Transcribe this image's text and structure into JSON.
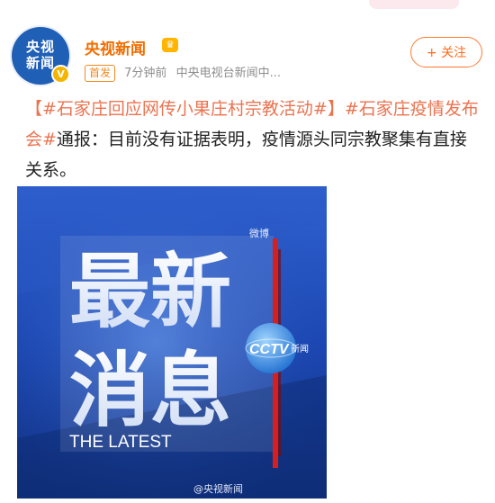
{
  "account": {
    "name": "央视新闻",
    "avatar_text": "央视\n新闻",
    "avatar_badge": "V",
    "vip_icon": "crown-badge-icon"
  },
  "meta": {
    "tag": "首发",
    "time": "7分钟前",
    "source": "中央电视台新闻中..."
  },
  "follow_label": "+ 关注",
  "post": {
    "hashtag1": "【#石家庄回应网传小果庄村宗教活动#】",
    "hashtag2": "#石家庄疫情发布会#",
    "body": "通报：目前没有证据表明，疫情源头同宗教聚集有直接关系。"
  },
  "image": {
    "headline_line1": "最新",
    "headline_line2": "消息",
    "subtitle": "THE LATEST",
    "top_watermark": "微博",
    "logo_text": "CCTV",
    "logo_sub": "新闻",
    "bottom_watermark": "@央视新闻"
  },
  "colors": {
    "accent_orange": "#f26d00",
    "hashtag": "#eb7350",
    "image_blue": "#1d46b0",
    "red_stripe": "#d62020"
  }
}
